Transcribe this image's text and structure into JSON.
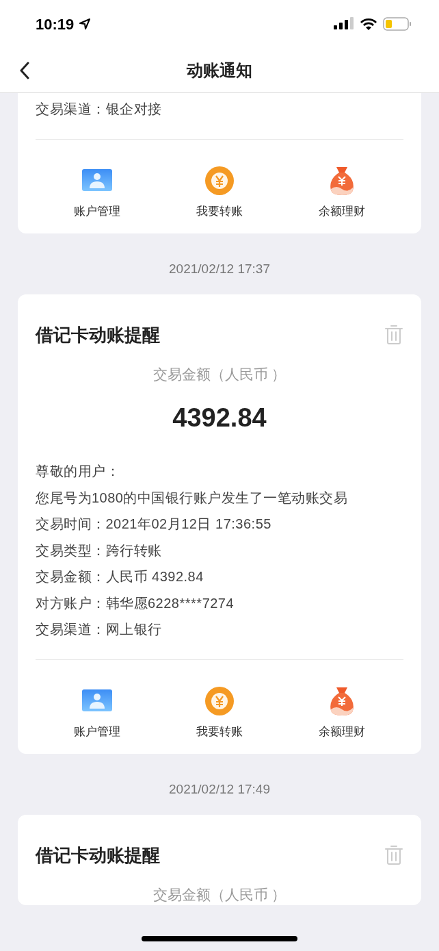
{
  "status_bar": {
    "time": "10:19"
  },
  "header": {
    "title": "动账通知"
  },
  "notices": [
    {
      "lines": [
        "交易渠道：银企对接"
      ],
      "actions": [
        {
          "label": "账户管理",
          "kind": "account"
        },
        {
          "label": "我要转账",
          "kind": "transfer"
        },
        {
          "label": "余额理财",
          "kind": "wealth"
        }
      ]
    },
    {
      "date": "2021/02/12 17:37",
      "title": "借记卡动账提醒",
      "subtitle": "交易金额（人民币 ）",
      "amount": "4392.84",
      "lines": [
        "尊敬的用户：",
        "您尾号为1080的中国银行账户发生了一笔动账交易",
        "交易时间：2021年02月12日 17:36:55",
        "交易类型：跨行转账",
        "交易金额：人民币 4392.84",
        "对方账户：韩华愿6228****7274",
        "交易渠道：网上银行"
      ],
      "actions": [
        {
          "label": "账户管理",
          "kind": "account"
        },
        {
          "label": "我要转账",
          "kind": "transfer"
        },
        {
          "label": "余额理财",
          "kind": "wealth"
        }
      ]
    },
    {
      "date": "2021/02/12 17:49",
      "title": "借记卡动账提醒",
      "subtitle": "交易金额（人民币 ）"
    }
  ]
}
